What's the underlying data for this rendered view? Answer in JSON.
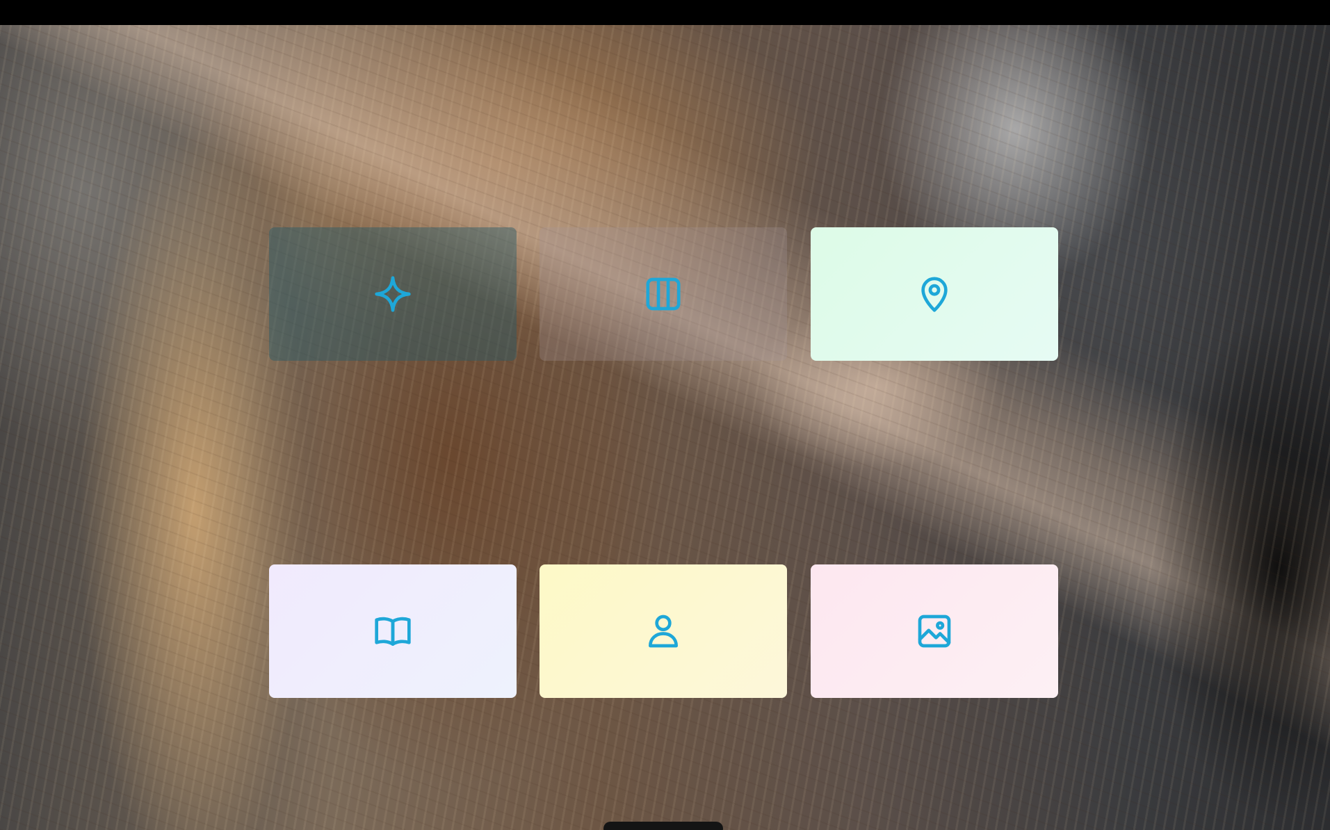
{
  "tiles": [
    {
      "id": "sparkle",
      "icon": "sparkle-icon",
      "background": "translucent-teal"
    },
    {
      "id": "columns",
      "icon": "columns-icon",
      "background": "translucent-gray"
    },
    {
      "id": "location",
      "icon": "map-pin-icon",
      "background": "#ddfbe7"
    },
    {
      "id": "book",
      "icon": "book-open-icon",
      "background": "#f1eafd"
    },
    {
      "id": "user",
      "icon": "user-icon",
      "background": "#fdf9c7"
    },
    {
      "id": "image",
      "icon": "image-icon",
      "background": "#fde7f0"
    }
  ],
  "accent_color": "#1ea7d8"
}
